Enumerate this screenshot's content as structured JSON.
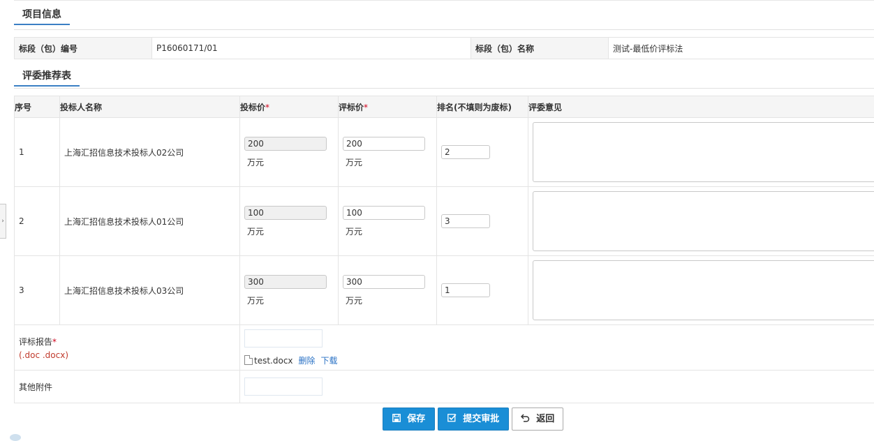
{
  "project_section": {
    "title": "项目信息"
  },
  "info": {
    "code_label": "标段（包）编号",
    "code_value": "P16060171/01",
    "name_label": "标段（包）名称",
    "name_value": "测试-最低价评标法"
  },
  "recommend_section": {
    "title": "评委推荐表"
  },
  "table": {
    "headers": {
      "seq": "序号",
      "bidder": "投标人名称",
      "bid_price": "投标价",
      "eval_price": "评标价",
      "rank": "排名(不填则为废标)",
      "opinion": "评委意见"
    },
    "required_mark": "*",
    "rows": [
      {
        "seq": "1",
        "bidder": "上海汇招信息技术投标人02公司",
        "bid_price": "200",
        "eval_price": "200",
        "unit": "万元",
        "rank": "2"
      },
      {
        "seq": "2",
        "bidder": "上海汇招信息技术投标人01公司",
        "bid_price": "100",
        "eval_price": "100",
        "unit": "万元",
        "rank": "3"
      },
      {
        "seq": "3",
        "bidder": "上海汇招信息技术投标人03公司",
        "bid_price": "300",
        "eval_price": "300",
        "unit": "万元",
        "rank": "1"
      }
    ]
  },
  "attachments": {
    "report_label": "评标报告",
    "report_formats": "(.doc .docx)",
    "file_name": "test.docx",
    "delete_label": "删除",
    "download_label": "下载",
    "other_label": "其他附件"
  },
  "buttons": {
    "save": "保存",
    "submit": "提交审批",
    "back": "返回"
  },
  "colors": {
    "primary": "#1a8ed6",
    "accent_underline": "#3b7fc4",
    "required": "#d0021b",
    "link": "#2a72c5"
  },
  "icons": {
    "save": "floppy-icon",
    "submit": "checkbox-edit-icon",
    "back": "return-arrow-icon",
    "side": "chevron-right-icon",
    "file": "document-icon"
  }
}
